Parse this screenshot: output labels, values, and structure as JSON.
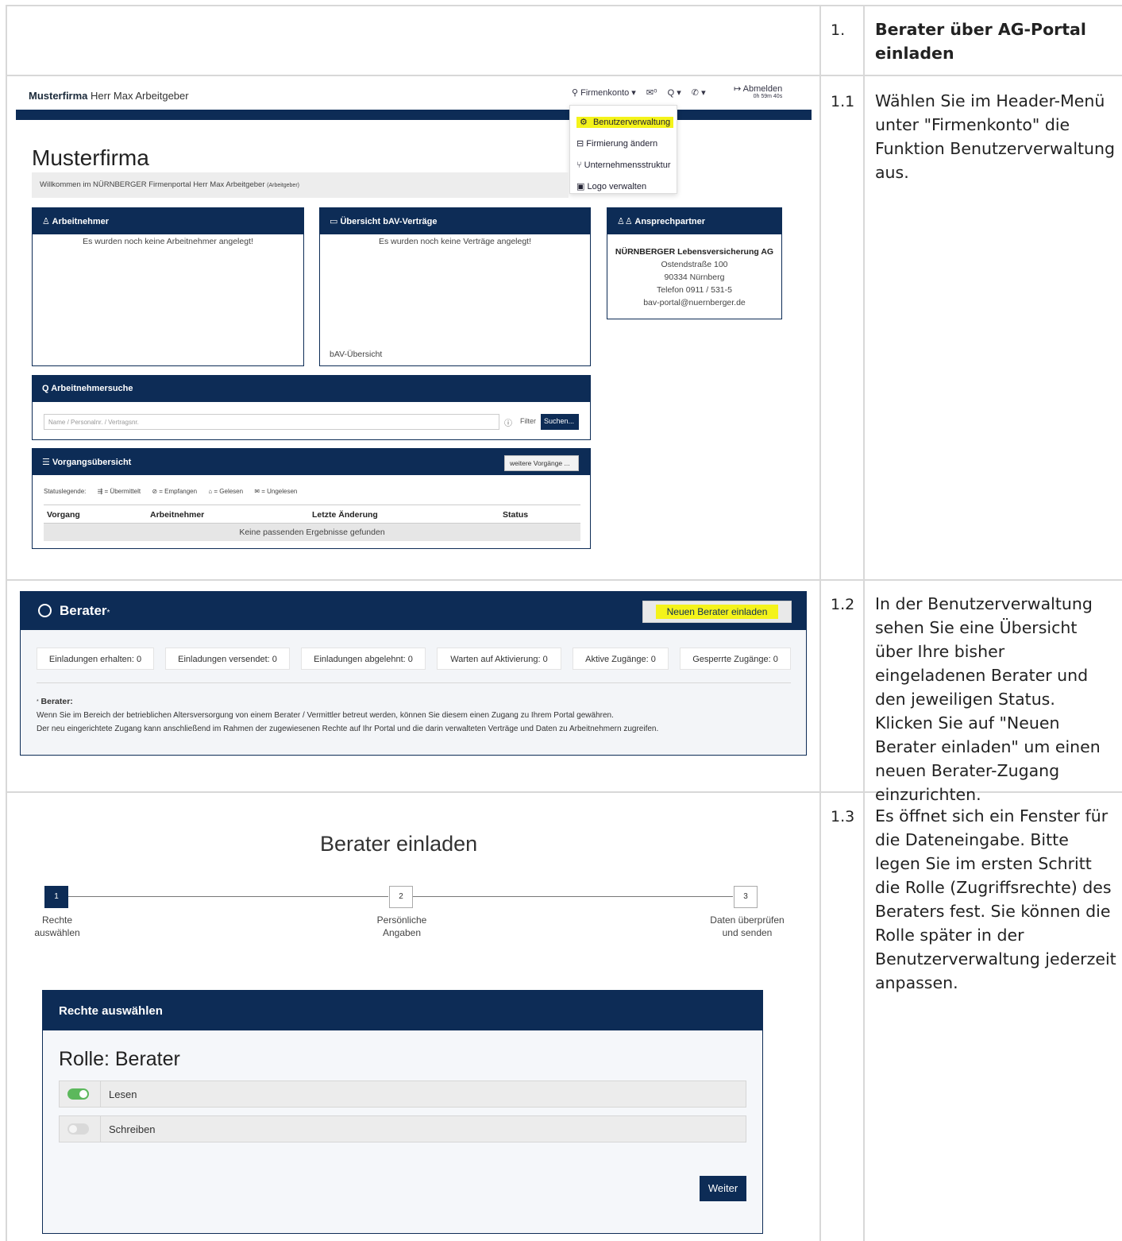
{
  "steps": {
    "s1": {
      "num": "1.",
      "title": "Berater über AG-Portal einladen"
    },
    "s11": {
      "num": "1.1",
      "text": "Wählen Sie im Header-Menü unter \"Firmenkonto\" die Funktion Benutzerverwaltung aus."
    },
    "s12": {
      "num": "1.2",
      "text": "In der Benutzerverwaltung sehen Sie eine Übersicht über Ihre bisher eingeladenen Berater und den jeweiligen Status. Klicken Sie auf \"Neuen Berater einladen\" um einen neuen Berater-Zugang einzurichten."
    },
    "s13": {
      "num": "1.3",
      "text": "Es öffnet sich ein Fenster für die Dateneingabe. Bitte legen Sie im ersten Schritt die Rolle (Zugriffsrechte) des Beraters fest. Sie können die Rolle später in der Benutzerverwaltung jederzeit anpassen."
    }
  },
  "dashboard": {
    "brand_company": "Musterfirma",
    "brand_user": "Herr Max Arbeitgeber",
    "nav": {
      "firmenkonto": "⚲ Firmenkonto ▾",
      "mail": "✉⁰",
      "search": "Q ▾",
      "phone": "✆ ▾",
      "logout": "↦ Abmelden",
      "timer": "0h 59m 40s"
    },
    "menu": [
      "Benutzerverwaltung",
      "Firmierung ändern",
      "Unternehmensstruktur",
      "Logo verwalten"
    ],
    "menu_icons": [
      "⚙",
      "⊟",
      "⑂",
      "▣"
    ],
    "title": "Musterfirma",
    "welcome": "Willkommen im NÜRNBERGER Firmenportal Herr Max Arbeitgeber",
    "welcome_role": "(Arbeitgeber)",
    "cards": {
      "an": {
        "title": "♙ Arbeitnehmer",
        "text": "Es wurden noch keine Arbeitnehmer angelegt!"
      },
      "bav": {
        "title": "▭ Übersicht bAV-Verträge",
        "text": "Es wurden noch keine Verträge angelegt!",
        "link": "bAV-Übersicht"
      },
      "ap": {
        "title": "♙♙ Ansprechpartner",
        "company": "NÜRNBERGER Lebensversicherung AG",
        "street": "Ostendstraße 100",
        "city": "90334 Nürnberg",
        "phone": "Telefon 0911 / 531-5",
        "email": "bav-portal@nuernberger.de"
      }
    },
    "search": {
      "title": "Q Arbeitnehmersuche",
      "placeholder": "Name / Personalnr. / Vertragsnr.",
      "info": "ⓘ",
      "filter": "Filter",
      "button": "Suchen..."
    },
    "vorgang": {
      "title": "☰ Vorgangsübersicht",
      "more": "weitere Vorgänge ...",
      "legend_label": "Statuslegende:",
      "legend": [
        "⇶ = Übermittelt",
        "⊘ = Empfangen",
        "⌂ = Gelesen",
        "✉ = Ungelesen"
      ],
      "columns": [
        "Vorgang",
        "Arbeitnehmer",
        "Letzte Änderung",
        "Status"
      ],
      "empty": "Keine passenden Ergebnisse gefunden"
    }
  },
  "berater": {
    "title": "Berater",
    "asterisk": "*",
    "invite": "Neuen Berater einladen",
    "stats": [
      "Einladungen erhalten: 0",
      "Einladungen versendet: 0",
      "Einladungen abgelehnt: 0",
      "Warten auf Aktivierung: 0",
      "Aktive Zugänge: 0",
      "Gesperrte Zugänge: 0"
    ],
    "note_label": "Berater:",
    "note_line1": "Wenn Sie im Bereich der betrieblichen Altersversorgung von einem Berater / Vermittler betreut werden, können Sie diesem einen Zugang zu Ihrem Portal gewähren.",
    "note_line2": "Der neu eingerichtete Zugang kann anschließend im Rahmen der zugewiesenen Rechte auf Ihr Portal und die darin verwalteten Verträge und Daten zu Arbeitnehmern zugreifen."
  },
  "wizard": {
    "title": "Berater einladen",
    "steps": [
      {
        "num": "1",
        "label1": "Rechte",
        "label2": "auswählen"
      },
      {
        "num": "2",
        "label1": "Persönliche",
        "label2": "Angaben"
      },
      {
        "num": "3",
        "label1": "Daten überprüfen",
        "label2": "und senden"
      }
    ],
    "panel_title": "Rechte auswählen",
    "role": "Rolle: Berater",
    "permissions": [
      {
        "label": "Lesen",
        "enabled": true
      },
      {
        "label": "Schreiben",
        "enabled": false
      }
    ],
    "next": "Weiter"
  }
}
